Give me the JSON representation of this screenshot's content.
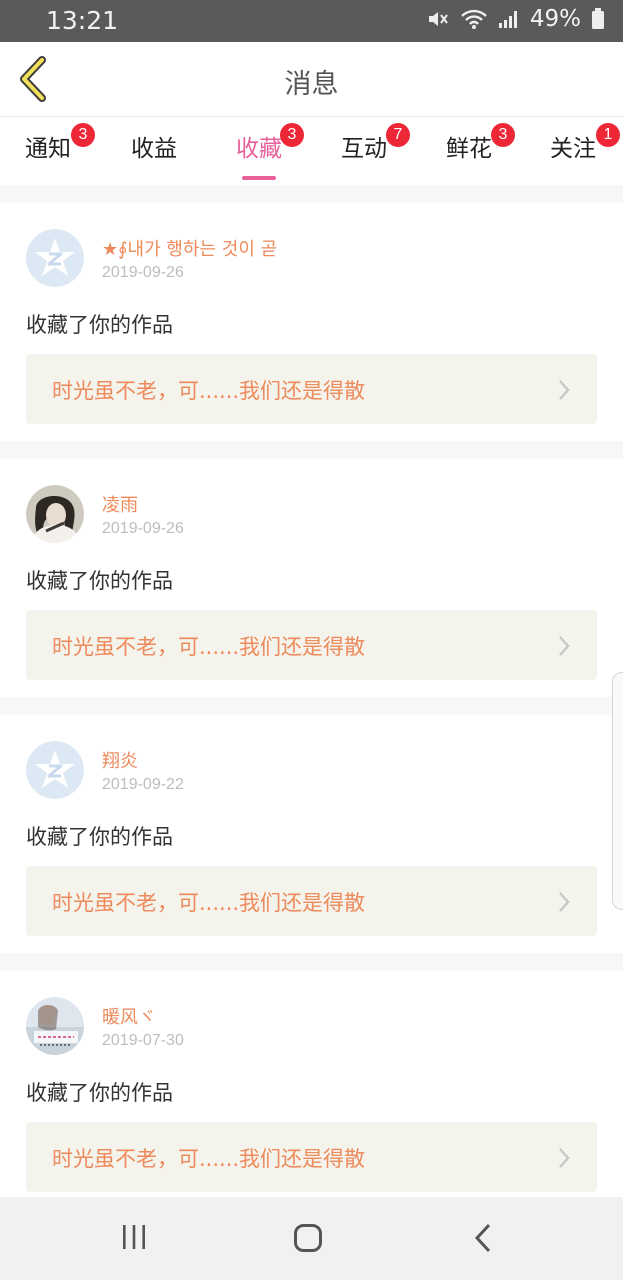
{
  "status_bar": {
    "time": "13:21",
    "battery": "49%",
    "icons": [
      "mute-icon",
      "wifi-icon",
      "signal-icon",
      "battery-icon"
    ]
  },
  "header": {
    "title": "消息",
    "back_icon": "back-arrow-icon"
  },
  "tabs": [
    {
      "label": "通知",
      "badge": "3",
      "active": false
    },
    {
      "label": "收益",
      "badge": "",
      "active": false
    },
    {
      "label": "收藏",
      "badge": "3",
      "active": true
    },
    {
      "label": "互动",
      "badge": "7",
      "active": false
    },
    {
      "label": "鲜花",
      "badge": "3",
      "active": false
    },
    {
      "label": "关注",
      "badge": "1",
      "active": false
    }
  ],
  "messages": [
    {
      "name": "★∮내가 행하는 것이 곧",
      "date": "2019-09-26",
      "action": "收藏了你的作品",
      "work_title": "时光虽不老，可......我们还是得散",
      "avatar": "qzone-default-avatar"
    },
    {
      "name": "凌雨",
      "date": "2019-09-26",
      "action": "收藏了你的作品",
      "work_title": "时光虽不老，可......我们还是得散",
      "avatar": "user-photo-avatar"
    },
    {
      "name": "翔炎",
      "date": "2019-09-22",
      "action": "收藏了你的作品",
      "work_title": "时光虽不老，可......我们还是得散",
      "avatar": "qzone-default-avatar"
    },
    {
      "name": "暖风ヾ",
      "date": "2019-07-30",
      "action": "收藏了你的作品",
      "work_title": "时光虽不老，可......我们还是得散",
      "avatar": "user-photo-avatar"
    }
  ],
  "nav_bar": {
    "icons": [
      "recent-apps-icon",
      "home-icon",
      "back-icon"
    ]
  },
  "colors": {
    "accent": "#e8609a",
    "name": "#ee8a5b",
    "badge": "#ee2737",
    "work_bg": "#f4f3ec"
  }
}
